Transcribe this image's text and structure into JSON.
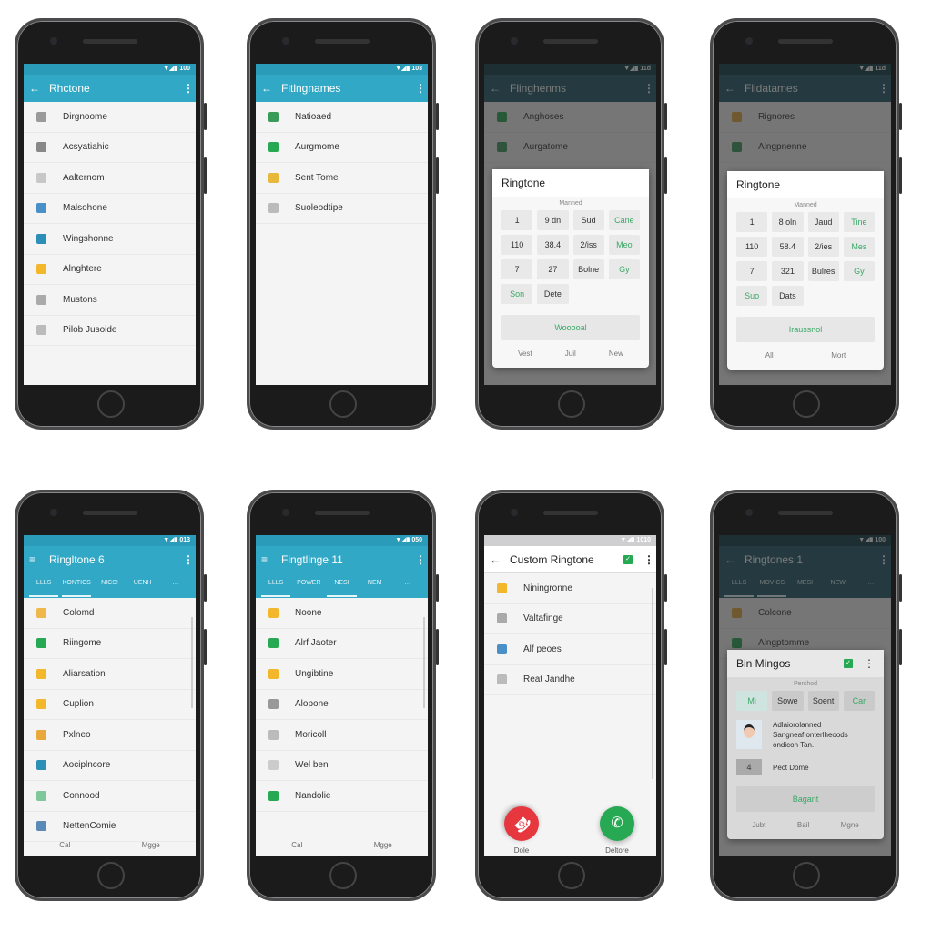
{
  "colors": {
    "appbar": "#31a8c6",
    "dim_appbar": "#1f5866",
    "accent_green": "#27a853",
    "decline_red": "#e5373d"
  },
  "phones": [
    {
      "theme": "teal",
      "status_time": "100",
      "nav_icon": "back-arrow",
      "title": "Rhctone",
      "items": [
        {
          "label": "Dirgnoome",
          "icon": "#9a9a9a"
        },
        {
          "label": "Acsyatiahic",
          "icon": "#888"
        },
        {
          "label": "Aalternom",
          "icon": "#c8c8c8"
        },
        {
          "label": "Malsohone",
          "icon": "#4a90c8"
        },
        {
          "label": "Wingshonne",
          "icon": "#2b8fb8"
        },
        {
          "label": "Alnghtere",
          "icon": "#f2b72a"
        },
        {
          "label": "Mustons",
          "icon": "#aaa"
        },
        {
          "label": "Pilob Jusoide",
          "icon": "#bbb"
        }
      ]
    },
    {
      "theme": "teal",
      "status_time": "103",
      "nav_icon": "back-arrow",
      "title": "Fitlngnames",
      "items": [
        {
          "label": "Natioaed",
          "icon": "#3a9a5a"
        },
        {
          "label": "Aurgmome",
          "icon": "#27a853"
        },
        {
          "label": "Sent Tome",
          "icon": "#e8b83a"
        },
        {
          "label": "Suoleodtipe",
          "icon": "#bbb"
        }
      ]
    },
    {
      "theme": "dim",
      "status_time": "11d",
      "nav_icon": "back-arrow",
      "title": "Flinghenms",
      "items": [
        {
          "label": "Anghoses",
          "icon": "#27a853"
        },
        {
          "label": "Aurgatome",
          "icon": "#3a9a5a"
        }
      ],
      "dialog": {
        "title": "Ringtone",
        "subtitle": "Manned",
        "cells": [
          {
            "t": "1"
          },
          {
            "t": "9 dn"
          },
          {
            "t": "Sud"
          },
          {
            "t": "Cane",
            "g": true
          },
          {
            "t": "110"
          },
          {
            "t": "38.4"
          },
          {
            "t": "2/iss"
          },
          {
            "t": "Meo",
            "g": true
          },
          {
            "t": "7"
          },
          {
            "t": "27"
          },
          {
            "t": "Bolne"
          },
          {
            "t": "Gy",
            "g": true
          },
          {
            "t": "Son",
            "g": true
          },
          {
            "t": "Dete"
          }
        ],
        "button": "Wooooal",
        "footer": [
          "Vest",
          "Juil",
          "New"
        ]
      }
    },
    {
      "theme": "dim",
      "status_time": "11d",
      "nav_icon": "back-arrow",
      "title": "Flidatames",
      "items": [
        {
          "label": "Rignores",
          "icon": "#e8a83a"
        },
        {
          "label": "Alngpnenne",
          "icon": "#3a9a5a"
        }
      ],
      "dialog": {
        "title": "Ringtone",
        "subtitle": "Manned",
        "cells": [
          {
            "t": "1"
          },
          {
            "t": "8 oln"
          },
          {
            "t": "Jaud"
          },
          {
            "t": "Tine",
            "g": true
          },
          {
            "t": "110"
          },
          {
            "t": "58.4"
          },
          {
            "t": "2/ies"
          },
          {
            "t": "Mes",
            "g": true
          },
          {
            "t": "7"
          },
          {
            "t": "321"
          },
          {
            "t": "Bulres"
          },
          {
            "t": "Gy",
            "g": true
          },
          {
            "t": "Suo",
            "g": true
          },
          {
            "t": "Dats"
          }
        ],
        "button": "Iraussnol",
        "footer": [
          "All",
          "Mort"
        ]
      }
    },
    {
      "theme": "teal",
      "status_time": "013",
      "nav_icon": "menu",
      "title": "Ringltone 6",
      "tabs": [
        "LLLS",
        "KONTICS",
        "NICS!",
        "UENH"
      ],
      "active_tab": 1,
      "items": [
        {
          "label": "Colomd",
          "icon": "#f0b84a"
        },
        {
          "label": "Riingome",
          "icon": "#27a853"
        },
        {
          "label": "Aliarsation",
          "icon": "#f2b72a"
        },
        {
          "label": "Cuplion",
          "icon": "#f2b72a"
        },
        {
          "label": "Pxlneo",
          "icon": "#e8a83a"
        },
        {
          "label": "Aociplncore",
          "icon": "#2b8fb8"
        },
        {
          "label": "Connood",
          "icon": "#7ec89a"
        },
        {
          "label": "NettenComie",
          "icon": "#5a8ab8"
        }
      ],
      "footer": [
        "Cal",
        "Mgge"
      ]
    },
    {
      "theme": "teal",
      "status_time": "050",
      "nav_icon": "menu",
      "title": "Fingtlinge 11",
      "tabs": [
        "LLLS",
        "POWER",
        "NESI",
        "NEM"
      ],
      "active_tab": 2,
      "items": [
        {
          "label": "Noone",
          "icon": "#f2b72a"
        },
        {
          "label": "Alrf Jaoter",
          "icon": "#27a853"
        },
        {
          "label": "Ungibtine",
          "icon": "#f2b72a"
        },
        {
          "label": "Alopone",
          "icon": "#999"
        },
        {
          "label": "Moricoll",
          "icon": "#bbb"
        },
        {
          "label": "Wel ben",
          "icon": "#ccc"
        },
        {
          "label": "Nandolie",
          "icon": "#27a853"
        }
      ],
      "footer": [
        "Cal",
        "Mgge"
      ]
    },
    {
      "theme": "white",
      "status_time": "1010",
      "nav_icon": "back-arrow",
      "title": "Custom Ringtone",
      "items": [
        {
          "label": "Niningronne",
          "icon": "#f2b72a"
        },
        {
          "label": "Valtafinge",
          "icon": "#aaa"
        },
        {
          "label": "Alf peoes",
          "icon": "#4a90c8"
        },
        {
          "label": "Reat Jandhe",
          "icon": "#bbb"
        }
      ],
      "call": {
        "decline_label": "Dole",
        "accept_label": "Deltore"
      }
    },
    {
      "theme": "dim",
      "status_time": "100",
      "nav_icon": "back-arrow",
      "title": "Ringtones 1",
      "tabs": [
        "LLLS",
        "MOVICS",
        "MESI",
        "NEW"
      ],
      "active_tab": 1,
      "items": [
        {
          "label": "Colcone",
          "icon": "#e8a83a"
        },
        {
          "label": "Alngptomme",
          "icon": "#27a853"
        }
      ],
      "dialog2": {
        "title": "Bin Mingos",
        "subtitle": "Pershod",
        "chips": [
          {
            "t": "Mi",
            "g": true
          },
          {
            "t": "Sowe"
          },
          {
            "t": "Soent"
          },
          {
            "t": "Car",
            "g": true
          }
        ],
        "profile_text": [
          "Adlaiorolanned",
          "Sangneaf onterlheoods",
          "ondicon Tan."
        ],
        "num": "4",
        "num_label": "Pect Dome",
        "button": "Bagant",
        "footer": [
          "Jubt",
          "Bail",
          "Mgne"
        ]
      }
    }
  ]
}
